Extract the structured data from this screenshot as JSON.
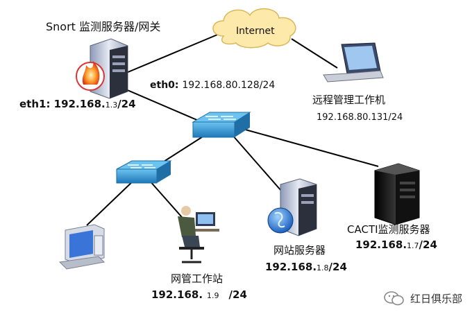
{
  "nodes": {
    "snort_server": {
      "title": "Snort 监测服务器/网关",
      "eth1_prefix": "eth1: 192.168.",
      "eth1_mid": "1.3",
      "eth1_suffix": "/24",
      "eth0_label": "eth0:",
      "eth0_ip": "192.168.80.128/24"
    },
    "internet": {
      "label": "Internet"
    },
    "remote_pc": {
      "label": "远程管理工作机",
      "ip": "192.168.80.131/24"
    },
    "cacti_server": {
      "label": "CACTI监测服务器",
      "ip_prefix": "192.168.",
      "ip_mid": "1.7",
      "ip_suffix": "/24"
    },
    "web_server": {
      "label": "网站服务器",
      "ip_prefix": "192.168.",
      "ip_mid": "1.8",
      "ip_suffix": "/24"
    },
    "admin_station": {
      "label": "网管工作站",
      "ip_prefix": "192.168.",
      "ip_mid": "1.9",
      "ip_suffix": "/24"
    }
  },
  "watermark": {
    "text": "红日俱乐部"
  },
  "colors": {
    "cloud": "#fde9a9",
    "cloud_stroke": "#d9b75a",
    "switch": "#3f9ed8",
    "switch_dark": "#1f6fa6",
    "server": "#cfd6e6",
    "server_dark": "#1a1a1a",
    "line": "#000000"
  }
}
